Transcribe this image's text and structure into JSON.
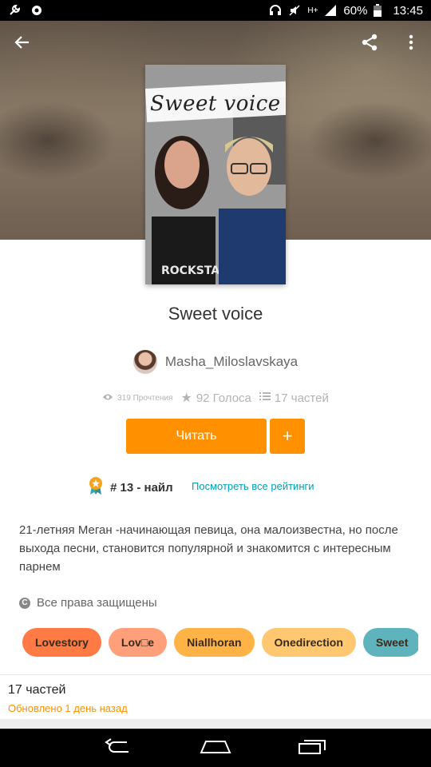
{
  "status_bar": {
    "battery": "60%",
    "time": "13:45",
    "signal": "H+",
    "icons": [
      "wrench-icon",
      "settings-icon",
      "headphones-icon",
      "mute-icon",
      "signal-icon",
      "battery-icon"
    ]
  },
  "header": {
    "back_icon": "back-arrow-icon",
    "share_icon": "share-icon",
    "more_icon": "more-vert-icon"
  },
  "cover": {
    "title_text": "Sweet voice"
  },
  "story": {
    "title": "Sweet voice",
    "author": "Masha_Miloslavskaya",
    "reads": "319 Прочтения",
    "votes": "92 Голоса",
    "parts": "17 частей"
  },
  "actions": {
    "read_label": "Читать",
    "add_label": "+"
  },
  "ranking": {
    "text": "# 13 - найл",
    "link": "Посмотреть все рейтинги"
  },
  "description": "21-летняя Меган -начинающая певица, она малоизвестна, но после выхода песни, становится популярной и знакомится с интересным парнем",
  "rights": "Все права защищены",
  "tags": [
    {
      "label": "Lovestory",
      "color": "#ff7a45"
    },
    {
      "label": "Lov□e",
      "color": "#ffa07a"
    },
    {
      "label": "Niallhoran",
      "color": "#ffb347"
    },
    {
      "label": "Onedirection",
      "color": "#ffc870"
    },
    {
      "label": "Sweet",
      "color": "#5fb3bd"
    }
  ],
  "parts_section": {
    "title": "17 частей",
    "updated": "Обновлено 1 день назад"
  },
  "colors": {
    "accent": "#ff9000",
    "link": "#00a0b4"
  }
}
